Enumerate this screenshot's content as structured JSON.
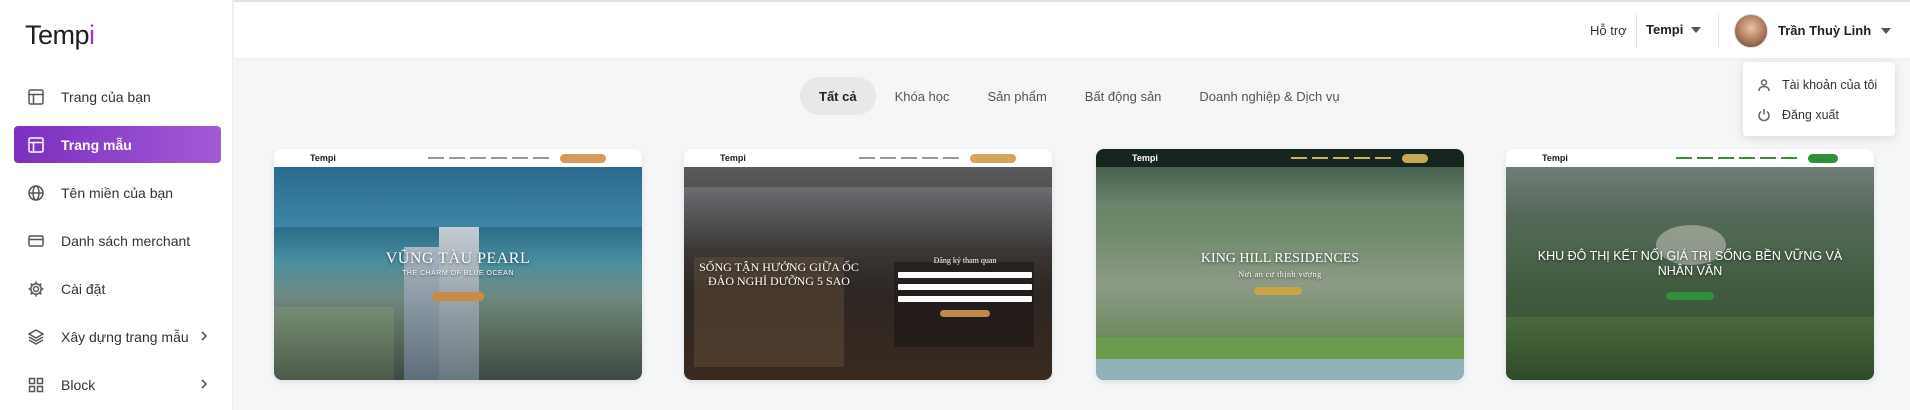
{
  "app": {
    "logo_main": "Temp",
    "logo_accent": "i"
  },
  "sidebar": {
    "items": [
      {
        "label": "Trang của bạn",
        "icon": "layout-icon"
      },
      {
        "label": "Trang mẫu",
        "icon": "layout-icon",
        "active": true
      },
      {
        "label": "Tên miền của bạn",
        "icon": "globe-icon"
      },
      {
        "label": "Danh sách merchant",
        "icon": "card-icon"
      },
      {
        "label": "Cài đặt",
        "icon": "gear-icon"
      },
      {
        "label": "Xây dựng trang mẫu",
        "icon": "layers-icon",
        "has_children": true
      },
      {
        "label": "Block",
        "icon": "grid-icon",
        "has_children": true
      }
    ]
  },
  "header": {
    "help": "Hỗ trợ",
    "workspace": "Tempi",
    "user_name": "Trần Thuỳ Linh"
  },
  "user_menu": {
    "items": [
      {
        "label": "Tài khoản của tôi",
        "icon": "user-icon"
      },
      {
        "label": "Đăng xuất",
        "icon": "power-icon"
      }
    ]
  },
  "tabs": [
    "Tất cả",
    "Khóa học",
    "Sản phẩm",
    "Bất động sản",
    "Doanh nghiệp & Dịch vụ"
  ],
  "templates": [
    {
      "title": "VŨNG TÀU PEARL",
      "subtitle": "THE CHARM OF BLUE OCEAN"
    },
    {
      "title": "SỐNG TẬN HƯỞNG GIỮA ỐC ĐẢO NGHỈ DƯỠNG 5 SAO",
      "form_title": "Đăng ký tham quan"
    },
    {
      "title": "KING HILL RESIDENCES",
      "subtitle": "Nơi an cư thịnh vượng"
    },
    {
      "title": "KHU ĐÔ THỊ KẾT NỐI GIÁ TRỊ SỐNG BỀN VỮNG VÀ NHÂN VĂN"
    }
  ],
  "colors": {
    "accent": "#8e3fcf",
    "sidebar_bg": "#ffffff",
    "page_bg": "#f5f6f8"
  }
}
